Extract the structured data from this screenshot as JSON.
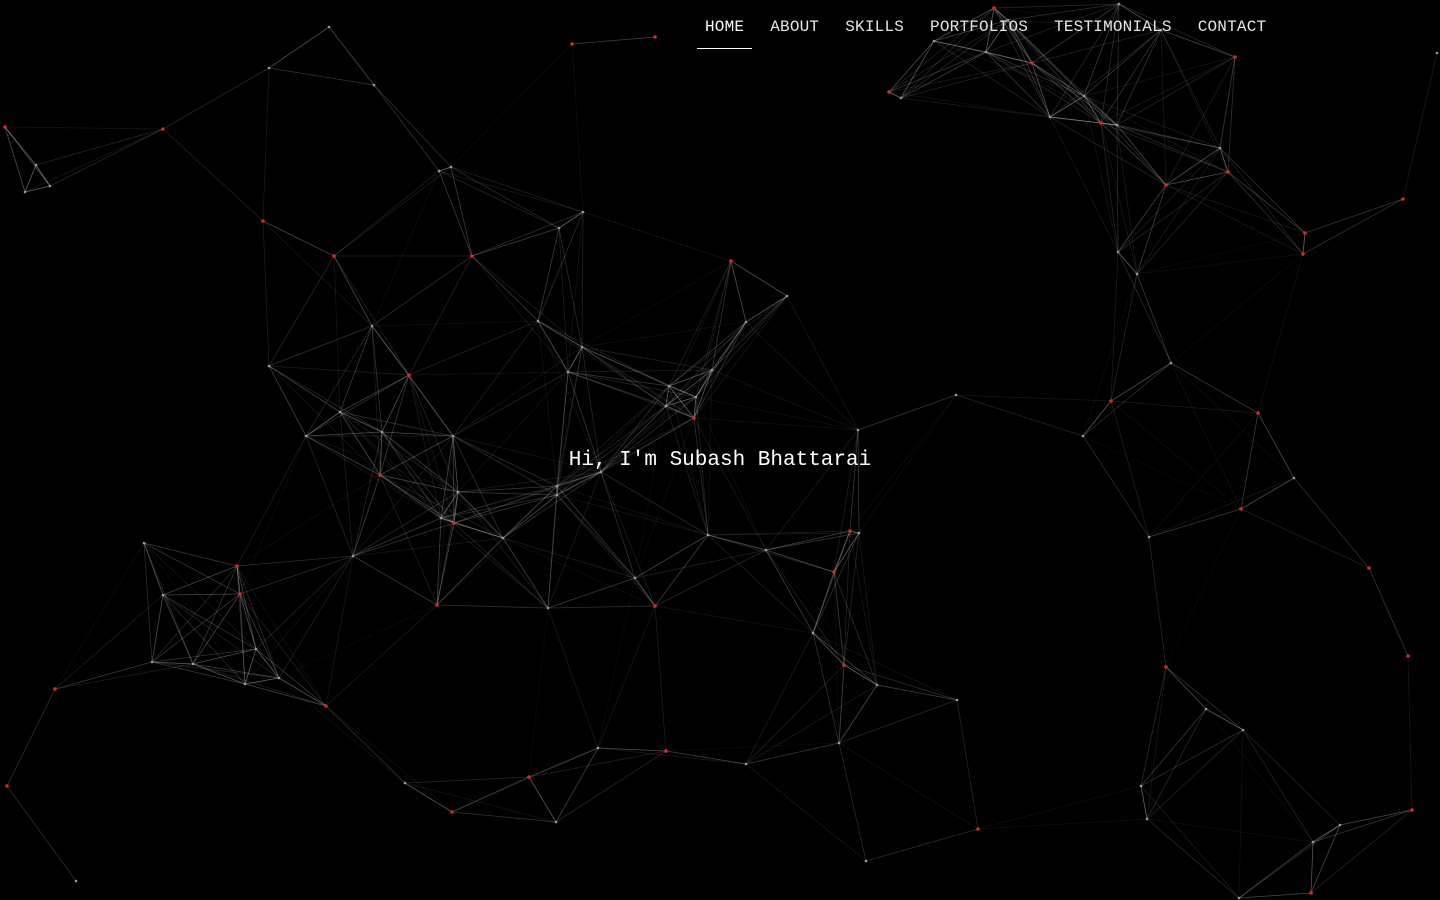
{
  "nav": {
    "items": [
      {
        "label": "HOME",
        "active": true
      },
      {
        "label": "ABOUT",
        "active": false
      },
      {
        "label": "SKILLS",
        "active": false
      },
      {
        "label": "PORTFOLIOS",
        "active": false
      },
      {
        "label": "TESTIMONIALS",
        "active": false
      },
      {
        "label": "CONTACT",
        "active": false
      }
    ]
  },
  "hero": {
    "greeting": "Hi, I'm Subash Bhattarai"
  },
  "theme": {
    "background": "#000000",
    "text": "#ffffff",
    "node_accent": "#d42a2a",
    "node_neutral": "#9a9a9a",
    "line": "#ffffff"
  }
}
